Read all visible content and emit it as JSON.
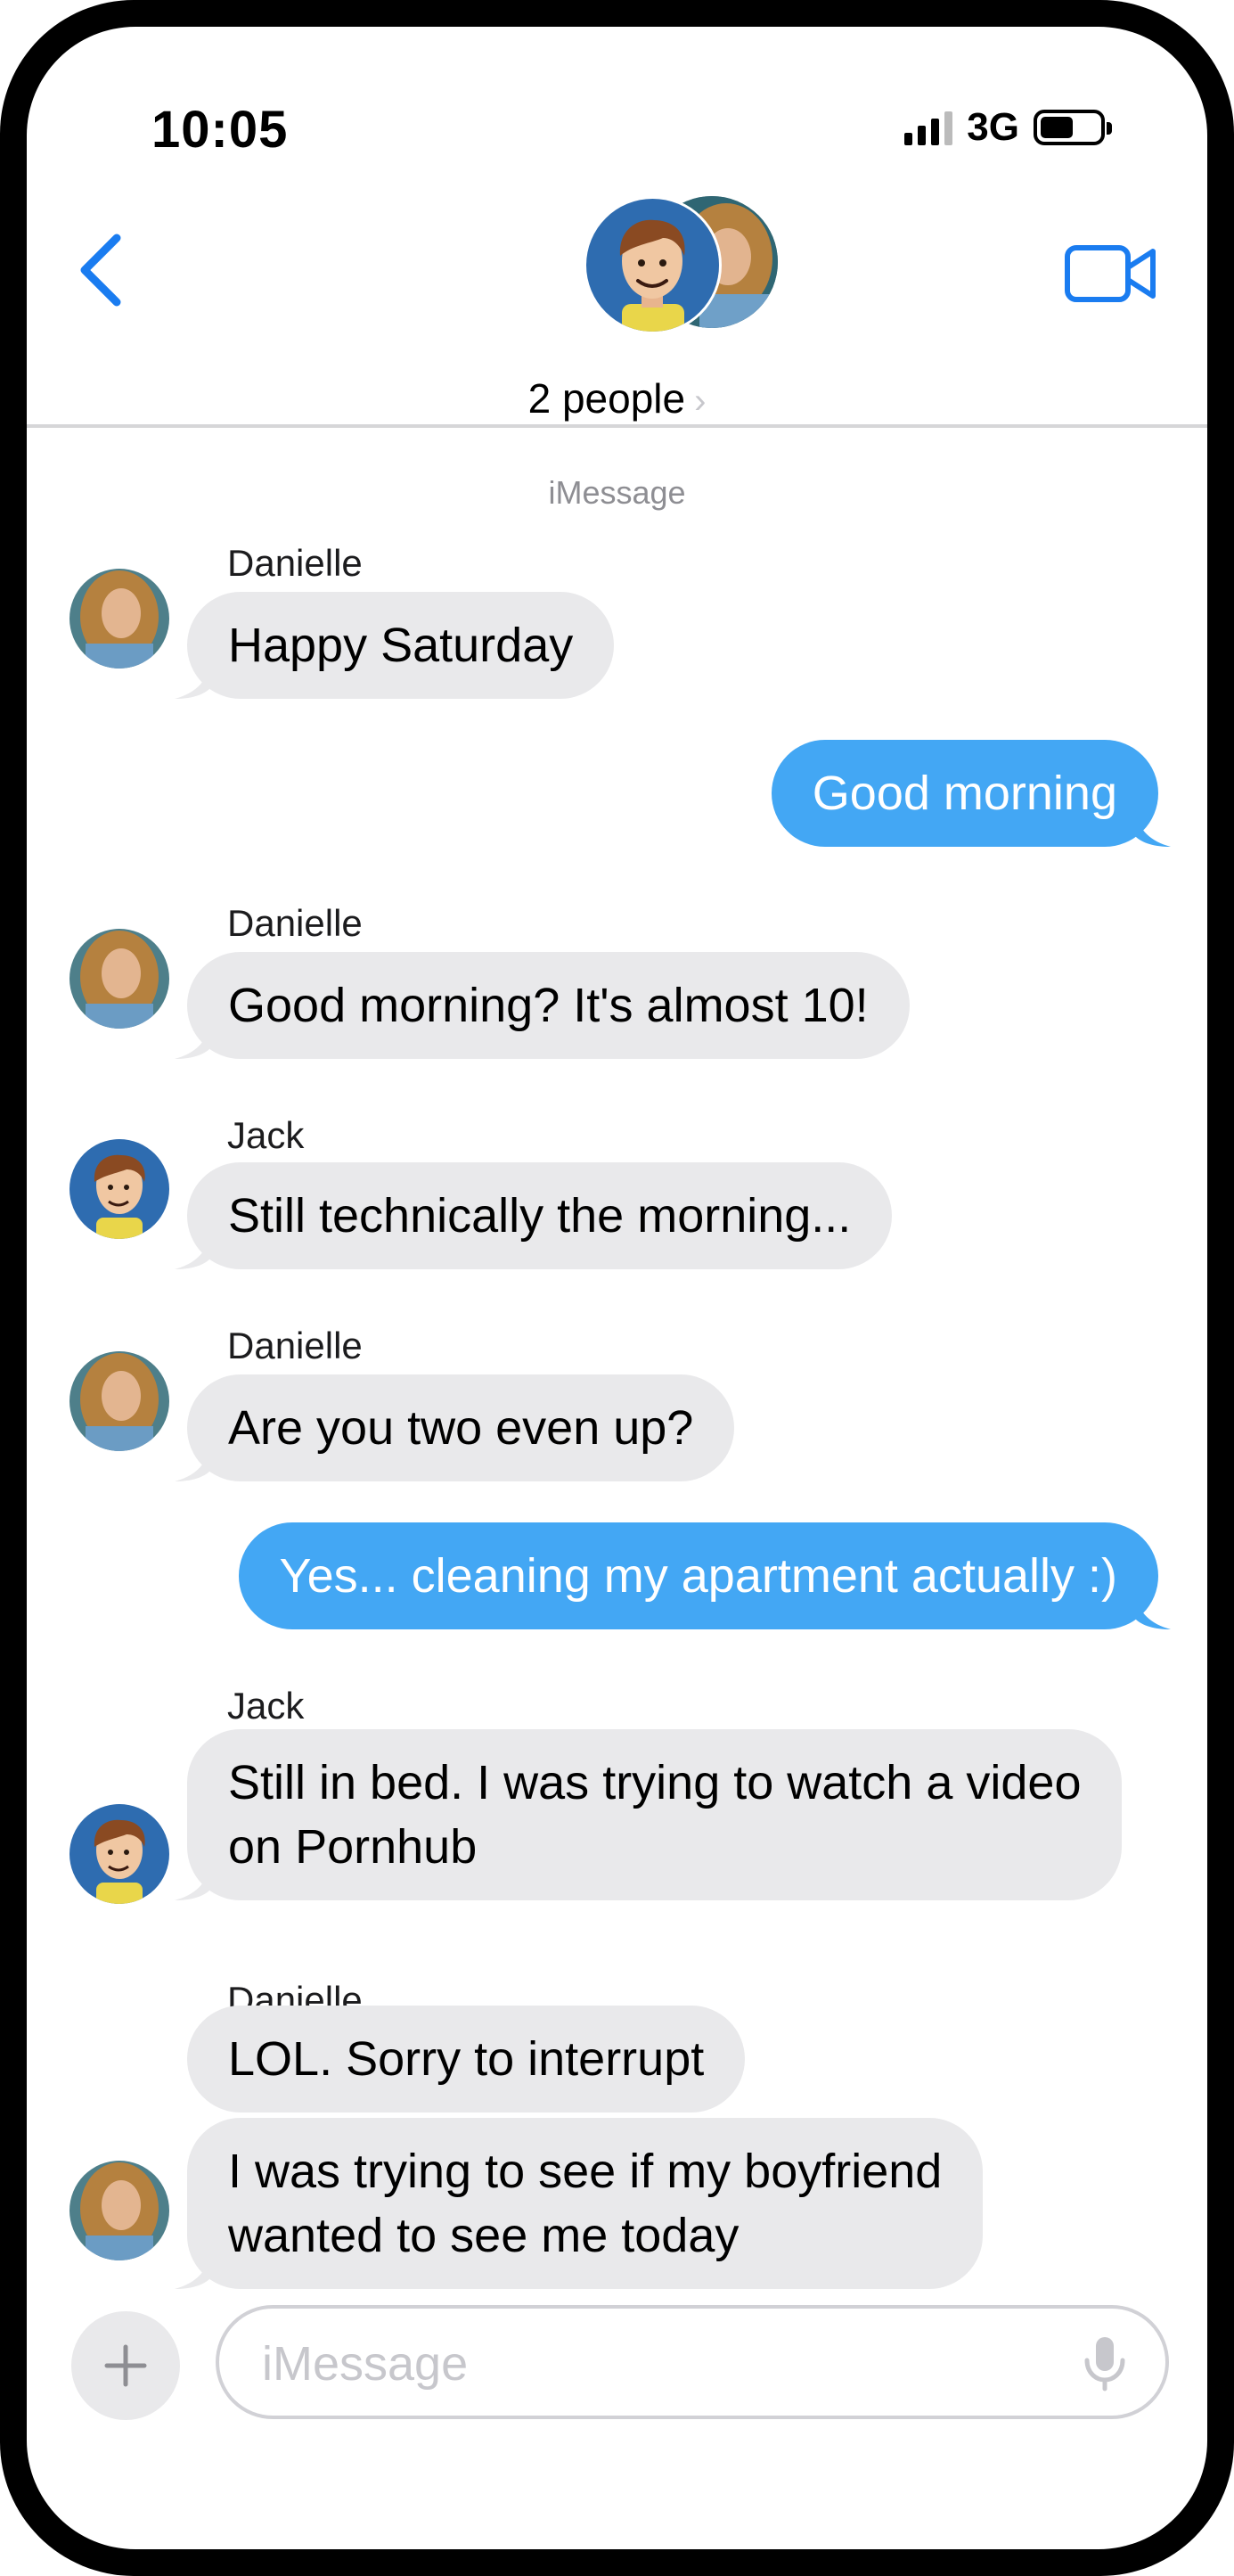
{
  "status_bar": {
    "time": "10:05",
    "network": "3G"
  },
  "header": {
    "people_label": "2 people",
    "chevron": "›"
  },
  "service_label": "iMessage",
  "messages": [
    {
      "sender": "Danielle",
      "text": "Happy Saturday"
    },
    {
      "sender": "",
      "text": "Good morning"
    },
    {
      "sender": "Danielle",
      "text": "Good morning?  It's almost 10!"
    },
    {
      "sender": "Jack",
      "text": "Still technically the morning..."
    },
    {
      "sender": "Danielle",
      "text": "Are you two even up?"
    },
    {
      "sender": "",
      "text": "Yes... cleaning my apartment actually :)"
    },
    {
      "sender": "Jack",
      "lines": [
        "Still in bed.  I was trying to watch a video",
        "on Pornhub"
      ]
    },
    {
      "sender": "Danielle",
      "text": "LOL.  Sorry to interrupt"
    },
    {
      "sender": "",
      "lines": [
        "I was trying to see if my boyfriend",
        "wanted to see me today"
      ]
    }
  ],
  "compose": {
    "placeholder": "iMessage"
  },
  "colors": {
    "accent": "#1a7cf0",
    "outgoing_bubble": "#43a7f4",
    "incoming_bubble": "#e9e9eb"
  },
  "icons": [
    "back-chevron-icon",
    "video-camera-icon",
    "plus-icon",
    "microphone-icon",
    "signal-icon",
    "battery-icon"
  ]
}
